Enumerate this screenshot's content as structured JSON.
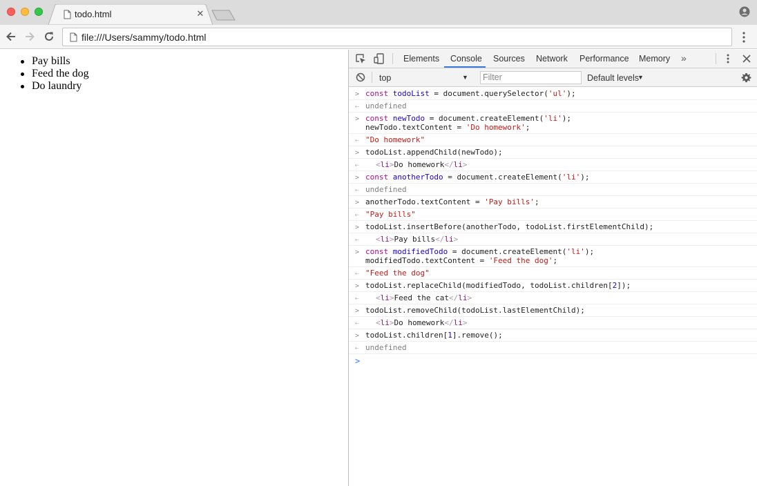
{
  "browser": {
    "tab_title": "todo.html",
    "url": "file:///Users/sammy/todo.html"
  },
  "page": {
    "items": [
      "Pay bills",
      "Feed the dog",
      "Do laundry"
    ]
  },
  "devtools": {
    "tabs": [
      "Elements",
      "Console",
      "Sources",
      "Network",
      "Performance",
      "Memory"
    ],
    "active_tab": "Console",
    "more_tabs": "»",
    "context": "top",
    "filter_placeholder": "Filter",
    "levels": "Default levels"
  },
  "console": {
    "undefined": "undefined",
    "r1_kw": "const",
    "r1_var": "todoList",
    "r1_rest": " = document.querySelector(",
    "r1_str": "'ul'",
    "r1_end": ");",
    "r3_kw": "const",
    "r3_var": "newTodo",
    "r3_rest": " = document.createElement(",
    "r3_str": "'li'",
    "r3_end": ");",
    "r3_l2": "newTodo.textContent = ",
    "r3_l2_str": "'Do homework'",
    "r3_l2_end": ";",
    "r4": "\"Do homework\"",
    "r5": "todoList.appendChild(newTodo);",
    "r6_open": "<li>",
    "r6_text": "Do homework",
    "r6_close": "</li>",
    "r7_kw": "const",
    "r7_var": "anotherTodo",
    "r7_rest": " = document.createElement(",
    "r7_str": "'li'",
    "r7_end": ");",
    "r9": "anotherTodo.textContent = ",
    "r9_str": "'Pay bills'",
    "r9_end": ";",
    "r10": "\"Pay bills\"",
    "r11": "todoList.insertBefore(anotherTodo, todoList.firstElementChild);",
    "r12_open": "<li>",
    "r12_text": "Pay bills",
    "r12_close": "</li>",
    "r13_kw": "const",
    "r13_var": "modifiedTodo",
    "r13_rest": " = document.createElement(",
    "r13_str": "'li'",
    "r13_end": ");",
    "r13_l2": "modifiedTodo.textContent = ",
    "r13_l2_str": "'Feed the dog'",
    "r13_l2_end": ";",
    "r14": "\"Feed the dog\"",
    "r15_a": "todoList.replaceChild(modifiedTodo, todoList.children[",
    "r15_num": "2",
    "r15_b": "]);",
    "r16_open": "<li>",
    "r16_text": "Feed the cat",
    "r16_close": "</li>",
    "r17": "todoList.removeChild(todoList.lastElementChild);",
    "r18_open": "<li>",
    "r18_text": "Do homework",
    "r18_close": "</li>",
    "r19_a": "todoList.children[",
    "r19_num": "1",
    "r19_b": "].remove();"
  }
}
